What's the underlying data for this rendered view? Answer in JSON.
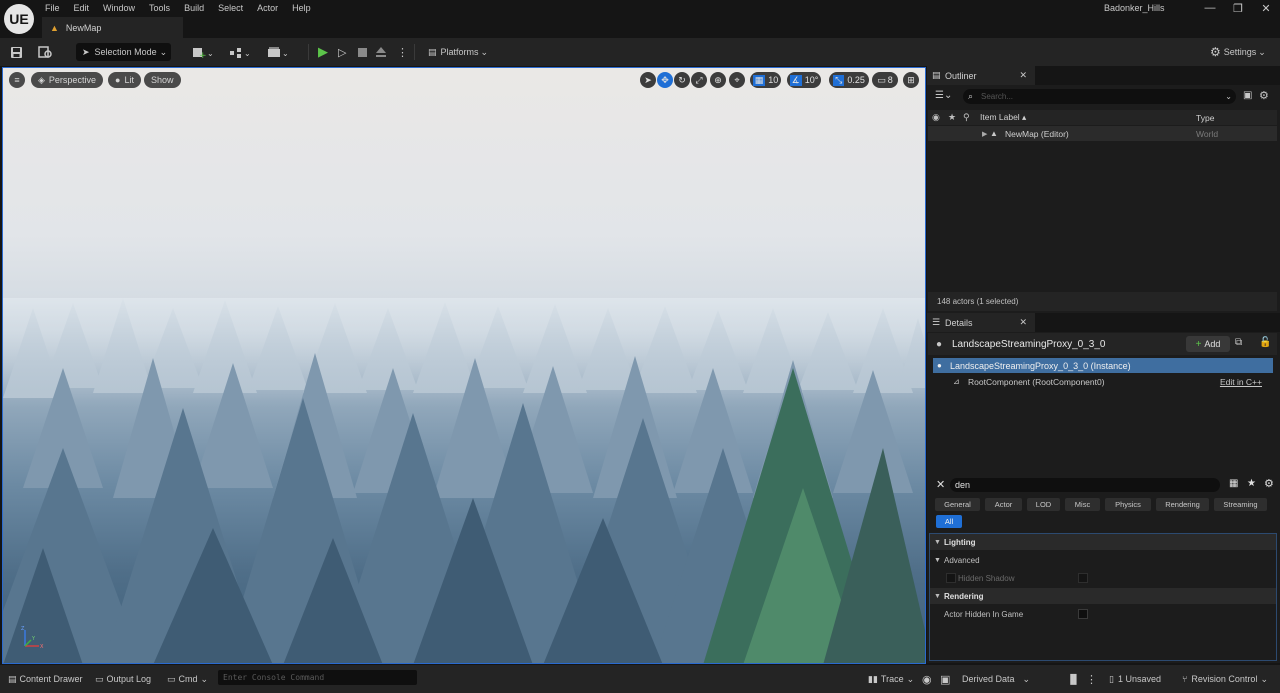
{
  "app": {
    "logo": "UE",
    "menu": [
      "File",
      "Edit",
      "Window",
      "Tools",
      "Build",
      "Select",
      "Actor",
      "Help"
    ],
    "map_tab": "NewMap",
    "project_name": "Badonker_Hills",
    "window_controls": {
      "minimize": "—",
      "maximize": "❐",
      "close": "✕"
    }
  },
  "toolbar": {
    "mode": "Selection Mode",
    "platforms": "Platforms",
    "settings": "Settings"
  },
  "viewport": {
    "view_mode": "Perspective",
    "lighting": "Lit",
    "show": "Show",
    "grid_snap": "10",
    "rotation_snap": "10°",
    "scale_snap": "0.25",
    "camera_speed": "8",
    "axis": {
      "x": "X",
      "y": "Y",
      "z": "Z"
    }
  },
  "outliner": {
    "tab": "Outliner",
    "search_placeholder": "Search...",
    "col_label": "Item Label ▴",
    "col_type": "Type",
    "row_label": "NewMap (Editor)",
    "row_type": "World",
    "status": "148 actors (1 selected)"
  },
  "details": {
    "tab": "Details",
    "actor_name": "LandscapeStreamingProxy_0_3_0",
    "add": "Add",
    "instance": "LandscapeStreamingProxy_0_3_0 (Instance)",
    "root_component": "RootComponent (RootComponent0)",
    "edit_cpp": "Edit in C++",
    "filter_value": "den",
    "categories": [
      "General",
      "Actor",
      "LOD",
      "Misc",
      "Physics",
      "Rendering",
      "Streaming"
    ],
    "all": "All",
    "sections": {
      "lighting": "Lighting",
      "advanced": "Advanced",
      "hidden_shadow": "Hidden Shadow",
      "rendering": "Rendering",
      "actor_hidden": "Actor Hidden In Game"
    }
  },
  "bottom": {
    "content_drawer": "Content Drawer",
    "output_log": "Output Log",
    "cmd": "Cmd",
    "console_placeholder": "Enter Console Command",
    "trace": "Trace",
    "derived_data": "Derived Data",
    "unsaved": "1 Unsaved",
    "revision_control": "Revision Control"
  },
  "colors": {
    "accent": "#1f6fd6",
    "play_green": "#5cc44a",
    "selection_blue": "#3f6ea0"
  }
}
